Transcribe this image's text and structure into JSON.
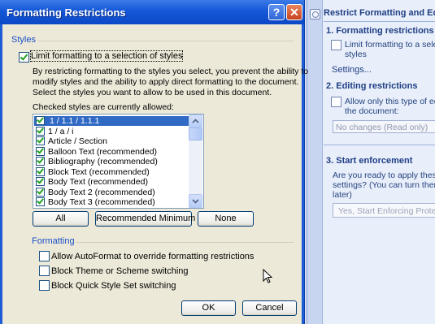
{
  "dialog": {
    "title": "Formatting Restrictions",
    "help_glyph": "?",
    "close_glyph": "✕",
    "styles_group": "Styles",
    "limit_label": "Limit formatting to a selection of styles",
    "limit_checked": true,
    "description": [
      "By restricting formatting to the styles you select, you prevent the ability to",
      "modify styles and the ability to apply direct formatting to the document.",
      "Select the styles you want to allow to be used in this document."
    ],
    "list_label": "Checked styles are currently allowed:",
    "styles_list": [
      {
        "label": "1 / 1.1 / 1.1.1",
        "checked": true,
        "selected": true
      },
      {
        "label": "1 / a / i",
        "checked": true,
        "selected": false
      },
      {
        "label": "Article / Section",
        "checked": true,
        "selected": false
      },
      {
        "label": "Balloon Text (recommended)",
        "checked": true,
        "selected": false
      },
      {
        "label": "Bibliography (recommended)",
        "checked": true,
        "selected": false
      },
      {
        "label": "Block Text (recommended)",
        "checked": true,
        "selected": false
      },
      {
        "label": "Body Text (recommended)",
        "checked": true,
        "selected": false
      },
      {
        "label": "Body Text 2 (recommended)",
        "checked": true,
        "selected": false
      },
      {
        "label": "Body Text 3 (recommended)",
        "checked": true,
        "selected": false
      }
    ],
    "buttons": {
      "all": "All",
      "recommended": "Recommended Minimum",
      "none": "None"
    },
    "formatting_group": "Formatting",
    "formatting_options": [
      {
        "label": "Allow AutoFormat to override formatting restrictions",
        "checked": false
      },
      {
        "label": "Block Theme or Scheme switching",
        "checked": false
      },
      {
        "label": "Block Quick Style Set switching",
        "checked": false
      }
    ],
    "ok_label": "OK",
    "cancel_label": "Cancel"
  },
  "task_pane": {
    "title": "Restrict Formatting and Edi",
    "section1_title": "1. Formatting restrictions",
    "section1_check_label": [
      "Limit formatting to a selec",
      "styles"
    ],
    "settings_link": "Settings...",
    "section2_title": "2. Editing restrictions",
    "section2_check_label": [
      "Allow only this type of edi",
      "the document:"
    ],
    "editing_dropdown": "No changes (Read only)",
    "section3_title": "3. Start enforcement",
    "section3_text": [
      "Are you ready to apply these",
      "settings? (You can turn them",
      "later)"
    ],
    "enforce_button": "Yes, Start Enforcing Protect"
  },
  "colors": {
    "titlebar_blue": "#1457d8",
    "selection_blue": "#316ac5",
    "group_label_blue": "#1c4ec6",
    "pane_heading": "#1e3f83"
  }
}
